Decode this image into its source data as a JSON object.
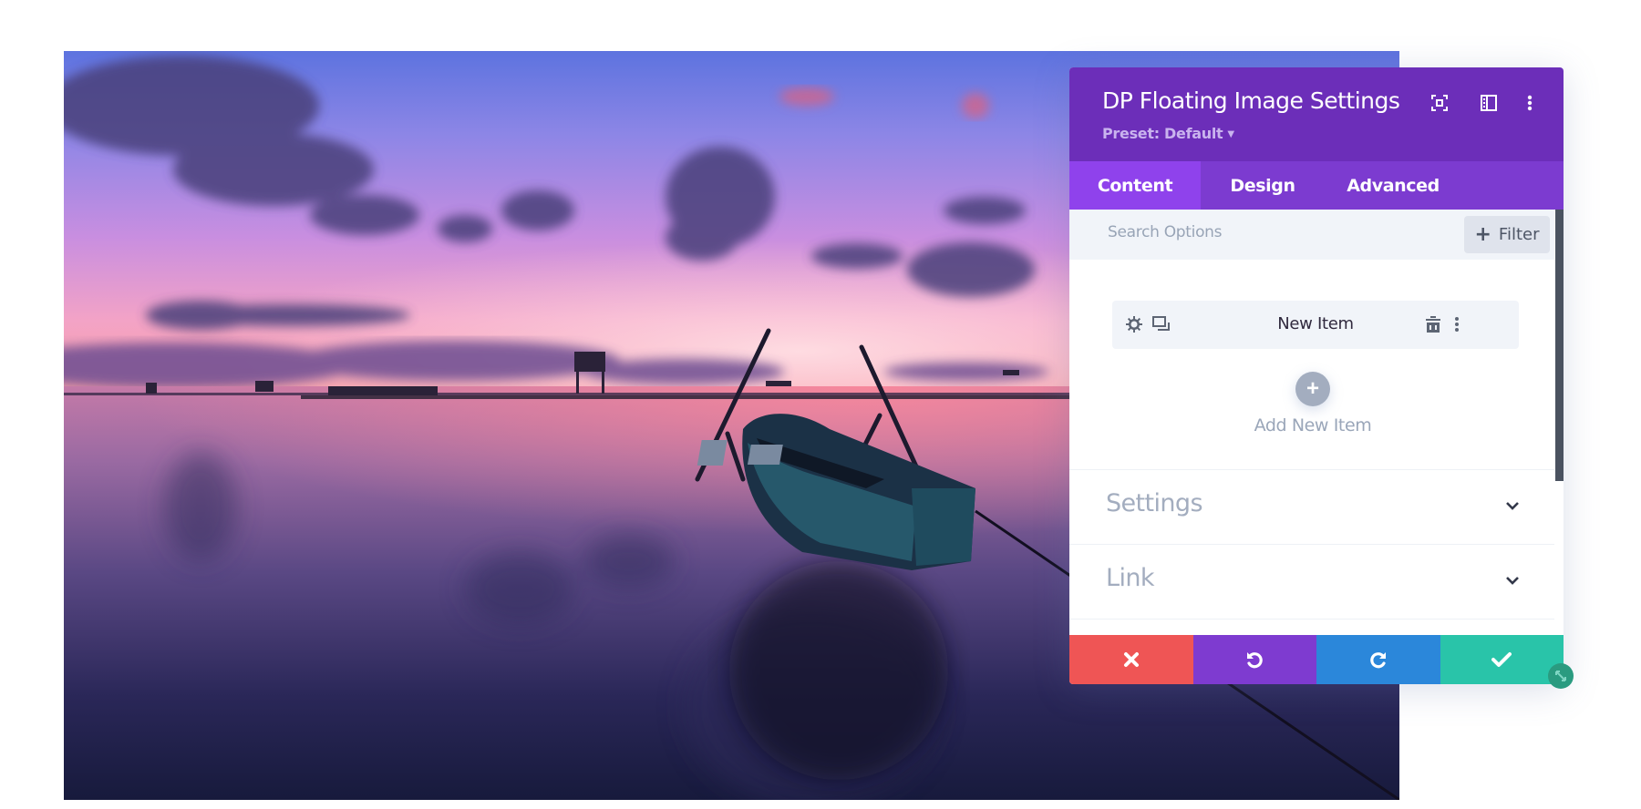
{
  "panel": {
    "title": "DP Floating Image Settings",
    "preset_label": "Preset: Default",
    "header_icons": [
      "focus-mode-icon",
      "sidebar-layout-icon",
      "more-options-icon"
    ],
    "tabs": [
      {
        "label": "Content",
        "active": true
      },
      {
        "label": "Design",
        "active": false
      },
      {
        "label": "Advanced",
        "active": false
      }
    ],
    "search": {
      "placeholder": "Search Options",
      "value": ""
    },
    "filter_label": "Filter",
    "items": [
      {
        "label": "New Item"
      }
    ],
    "add_item_label": "Add New Item",
    "toggles": [
      {
        "label": "Settings",
        "expanded": false
      },
      {
        "label": "Link",
        "expanded": false
      }
    ],
    "footer": {
      "cancel_color": "#ef5555",
      "undo_color": "#7e3bd0",
      "redo_color": "#2b87da",
      "save_color": "#29c4a9"
    },
    "colors": {
      "header": "#6c2eb9",
      "tab_bar": "#7c3bd0",
      "tab_active": "#8f42ec"
    }
  },
  "background_image": {
    "description": "Sunset over calm sea with wooden rowboat moored by two poles"
  }
}
